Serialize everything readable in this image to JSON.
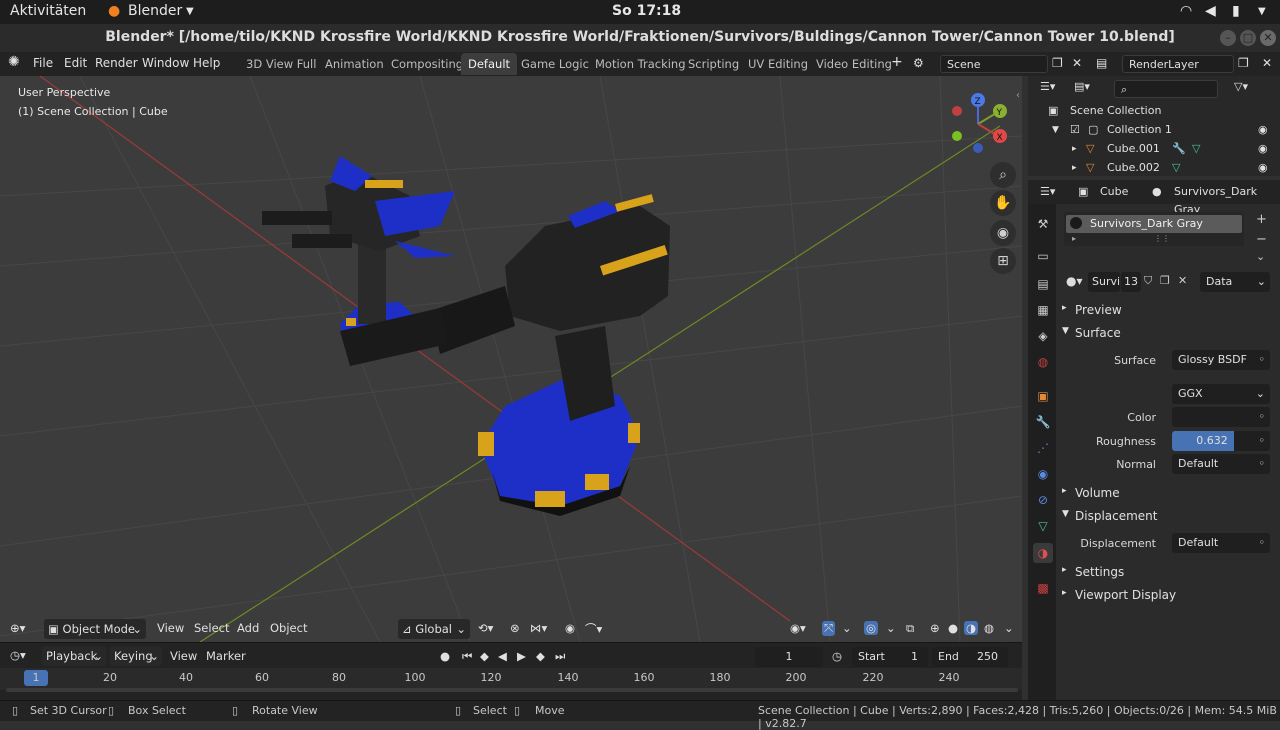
{
  "ubuntu": {
    "activities": "Aktivitäten",
    "app": "Blender",
    "clock": "So 17:18"
  },
  "window": {
    "title": "Blender* [/home/tilo/KKND Krossfire World/KKND Krossfire World/Fraktionen/Survivors/Buldings/Cannon Tower/Cannon Tower 10.blend]"
  },
  "menu": [
    "File",
    "Edit",
    "Render",
    "Window",
    "Help"
  ],
  "workspaces": [
    {
      "label": "3D View Full",
      "active": false
    },
    {
      "label": "Animation",
      "active": false
    },
    {
      "label": "Compositing",
      "active": false
    },
    {
      "label": "Default",
      "active": true
    },
    {
      "label": "Game Logic",
      "active": false
    },
    {
      "label": "Motion Tracking",
      "active": false
    },
    {
      "label": "Scripting",
      "active": false
    },
    {
      "label": "UV Editing",
      "active": false
    },
    {
      "label": "Video Editing",
      "active": false
    }
  ],
  "scene_field": "Scene",
  "renderlayer_field": "RenderLayer",
  "viewport": {
    "perspective": "User Perspective",
    "collection": "(1) Scene Collection | Cube"
  },
  "viewport_header": {
    "mode": "Object Mode",
    "menus": [
      "View",
      "Select",
      "Add",
      "Object"
    ],
    "orientation": "Global"
  },
  "gizmo": {
    "z": "Z",
    "y": "Y",
    "x": "X"
  },
  "timeline": {
    "menus": [
      "Playback",
      "Keying",
      "View",
      "Marker"
    ],
    "current_frame": "1",
    "start_label": "Start",
    "start": "1",
    "end_label": "End",
    "end": "250",
    "ruler": [
      "1",
      "20",
      "40",
      "60",
      "80",
      "100",
      "120",
      "140",
      "160",
      "180",
      "200",
      "220",
      "240"
    ]
  },
  "status": {
    "left": [
      "Set 3D Cursor",
      "Box Select",
      "Rotate View",
      "Select",
      "Move"
    ],
    "info": "Scene Collection | Cube | Verts:2,890 | Faces:2,428 | Tris:5,260 | Objects:0/26 | Mem: 54.5 MiB | v2.82.7"
  },
  "outliner": {
    "root": "Scene Collection",
    "collection": "Collection 1",
    "items": [
      "Cube.001",
      "Cube.002"
    ]
  },
  "properties": {
    "object": "Cube",
    "material": "Survivors_Dark Gray",
    "slot": "Survivors_Dark Gray",
    "mat_short": "Survi",
    "users": "13",
    "link": "Data",
    "panels": {
      "preview": "Preview",
      "surface": "Surface",
      "volume": "Volume",
      "displacement": "Displacement",
      "settings": "Settings",
      "viewport_display": "Viewport Display"
    },
    "surface_label": "Surface",
    "surface_value": "Glossy BSDF",
    "distribution": "GGX",
    "color_label": "Color",
    "roughness_label": "Roughness",
    "roughness": "0.632",
    "roughness_fraction": 0.632,
    "normal_label": "Normal",
    "normal_value": "Default",
    "disp_label": "Displacement",
    "disp_value": "Default"
  },
  "colors": {
    "accent": "#4772b3",
    "header": "#232323",
    "viewport": "#3c3c3c",
    "grid": "#4a4a4a",
    "x_axis": "#9b3a3a",
    "y_axis": "#6b8a26",
    "blue": "#1e2fc8",
    "gold": "#d8a21a"
  }
}
